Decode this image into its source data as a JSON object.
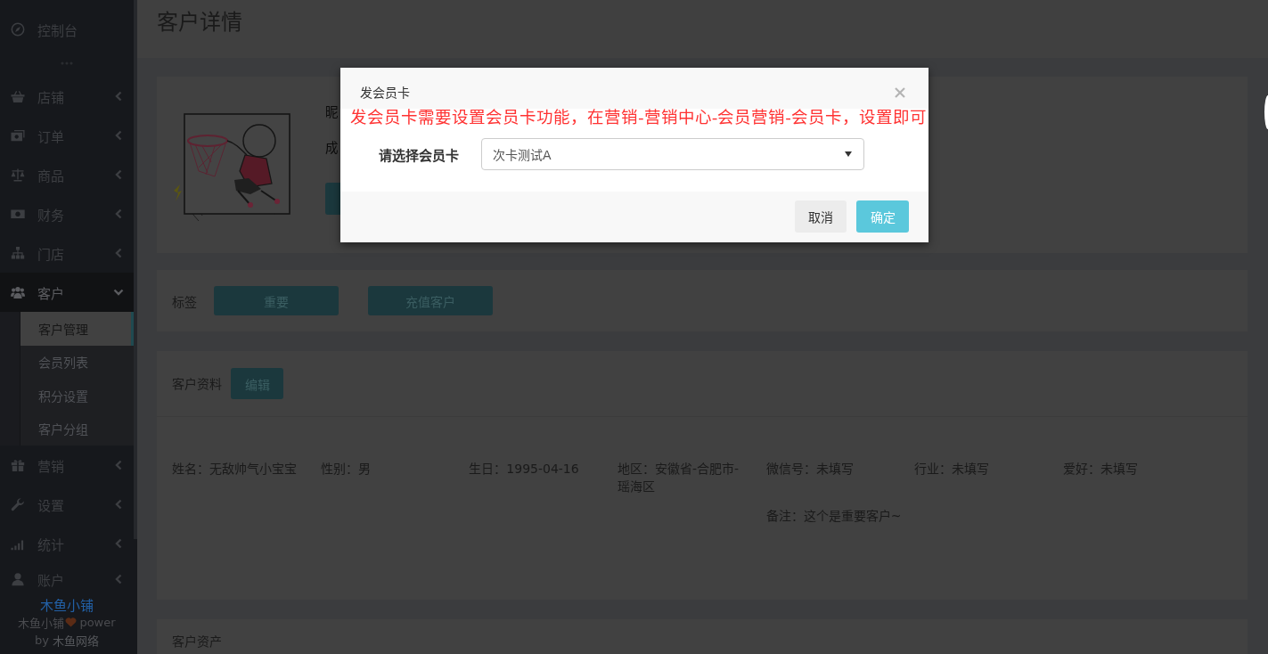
{
  "sidebar": {
    "items": [
      {
        "kind": "link",
        "label": "控制台",
        "expanded": false
      },
      {
        "kind": "divider"
      },
      {
        "kind": "menu",
        "label": "店铺",
        "expanded": false
      },
      {
        "kind": "menu",
        "label": "订单",
        "expanded": false
      },
      {
        "kind": "menu",
        "label": "商品",
        "expanded": false
      },
      {
        "kind": "menu",
        "label": "财务",
        "expanded": false
      },
      {
        "kind": "menu",
        "label": "门店",
        "expanded": false
      },
      {
        "kind": "menu",
        "label": "客户",
        "expanded": true,
        "children": [
          {
            "label": "客户管理",
            "selected": true
          },
          {
            "label": "会员列表",
            "selected": false
          },
          {
            "label": "积分设置",
            "selected": false
          },
          {
            "label": "客户分组",
            "selected": false
          }
        ]
      },
      {
        "kind": "menu",
        "label": "营销",
        "expanded": false
      },
      {
        "kind": "menu",
        "label": "设置",
        "expanded": false
      },
      {
        "kind": "menu",
        "label": "统计",
        "expanded": false
      },
      {
        "kind": "menu",
        "label": "账户",
        "expanded": false
      }
    ],
    "footer": {
      "brand": "木鱼小铺",
      "credit": "木鱼小铺",
      "power": "power",
      "by": "by",
      "company": "木鱼网络"
    }
  },
  "page_title": "客户详情",
  "profile": {
    "lines": [
      "昵",
      "成"
    ],
    "button": {
      "kind": "primary"
    }
  },
  "tags": {
    "label": "标签",
    "items": [
      "重要",
      "充值客户"
    ]
  },
  "info": {
    "title": "客户资料",
    "edit_button": "编辑",
    "fields": [
      "姓名：无敌帅气小宝宝",
      "性别：男",
      "生日：1995-04-16",
      "地区：安徽省-合肥市-瑶海区",
      "微信号：未填写",
      "行业：未填写",
      "爱好：未填写",
      "备注：这个是重要客户~"
    ]
  },
  "assets": {
    "title": "客户资产"
  },
  "modal": {
    "title": "发会员卡",
    "notice": "发会员卡需要设置会员卡功能，在营销-营销中心-会员营销-会员卡，设置即可",
    "field_label": "请选择会员卡",
    "select_value": "次卡测试A",
    "buttons": [
      {
        "label": "取消",
        "kind": "default"
      },
      {
        "label": "确定",
        "kind": "primary"
      }
    ]
  }
}
